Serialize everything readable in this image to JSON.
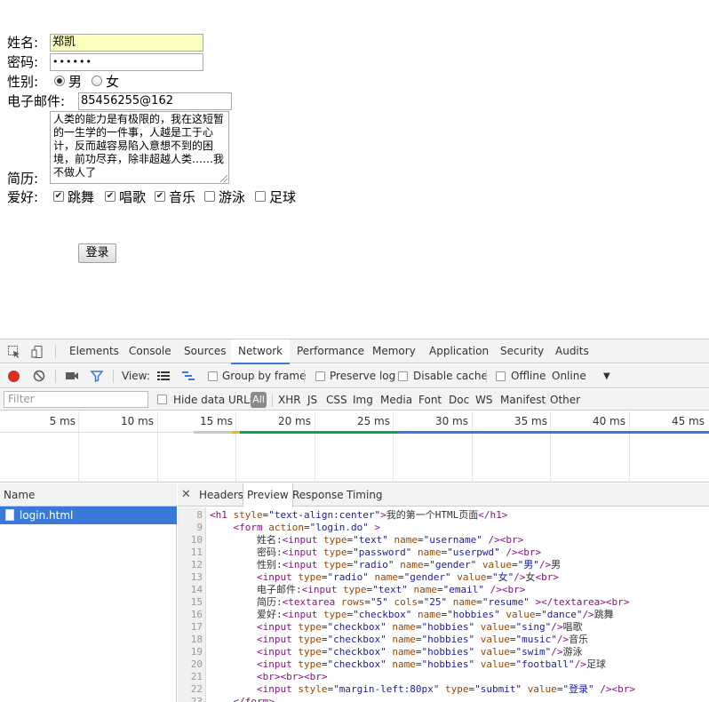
{
  "form": {
    "name_label": "姓名:",
    "name_value": "郑凯",
    "password_label": "密码:",
    "password_value": "••••••",
    "gender_label": "性别:",
    "gender_male": "男",
    "gender_female": "女",
    "email_label": "电子邮件:",
    "email_value": "85456255@162",
    "resume_label": "简历:",
    "resume_value": "人类的能力是有极限的，我在这短暂的一生学的一件事，人越是工于心计，反而越容易陷入意想不到的困境，前功尽弃，除非超越人类……我不做人了",
    "hobby_label": "爱好:",
    "hobbies": [
      {
        "label": "跳舞",
        "checked": true
      },
      {
        "label": "唱歌",
        "checked": true
      },
      {
        "label": "音乐",
        "checked": true
      },
      {
        "label": "游泳",
        "checked": false
      },
      {
        "label": "足球",
        "checked": false
      }
    ],
    "submit_label": "登录"
  },
  "devtools": {
    "tabs": [
      "Elements",
      "Console",
      "Sources",
      "Network",
      "Performance",
      "Memory",
      "Application",
      "Security",
      "Audits"
    ],
    "active_tab": "Network",
    "toolbar": {
      "view_label": "View:",
      "group_by_frame": "Group by frame",
      "preserve_log": "Preserve log",
      "disable_cache": "Disable cache",
      "offline": "Offline",
      "throttle": "Online"
    },
    "filter": {
      "placeholder": "Filter",
      "hide_data_urls": "Hide data URLs",
      "all": "All",
      "types": [
        "XHR",
        "JS",
        "CSS",
        "Img",
        "Media",
        "Font",
        "Doc",
        "WS",
        "Manifest",
        "Other"
      ]
    },
    "timeline_ticks": [
      "5 ms",
      "10 ms",
      "15 ms",
      "20 ms",
      "25 ms",
      "30 ms",
      "35 ms",
      "40 ms",
      "45 ms"
    ],
    "name_header": "Name",
    "requests": [
      "login.html"
    ],
    "detail_tabs": [
      "Headers",
      "Preview",
      "Response",
      "Timing"
    ],
    "active_detail_tab": "Preview",
    "code_lines": [
      {
        "n": "8",
        "html": "<span class='tag'>&lt;h1</span> <span class='attr'>style</span>=<span class='val'>\"text-align:center\"</span><span class='tag'>&gt;</span>我的第一个HTML页面<span class='tag'>&lt;/h1&gt;</span>"
      },
      {
        "n": "9",
        "html": "    <span class='tag'>&lt;form</span> <span class='attr'>action</span>=<span class='val'>\"login.do\"</span> <span class='tag'>&gt;</span>"
      },
      {
        "n": "10",
        "html": "        姓名:<span class='tag'>&lt;input</span> <span class='attr'>type</span>=<span class='val'>\"text\"</span> <span class='attr'>name</span>=<span class='val'>\"username\"</span> <span class='tag'>/&gt;&lt;br&gt;</span>"
      },
      {
        "n": "11",
        "html": "        密码:<span class='tag'>&lt;input</span> <span class='attr'>type</span>=<span class='val'>\"password\"</span> <span class='attr'>name</span>=<span class='val'>\"userpwd\"</span> <span class='tag'>/&gt;&lt;br&gt;</span>"
      },
      {
        "n": "12",
        "html": "        性别:<span class='tag'>&lt;input</span> <span class='attr'>type</span>=<span class='val'>\"radio\"</span> <span class='attr'>name</span>=<span class='val'>\"gender\"</span> <span class='attr'>value</span>=<span class='val'>\"男\"</span><span class='tag'>/&gt;</span>男"
      },
      {
        "n": "13",
        "html": "        <span class='tag'>&lt;input</span> <span class='attr'>type</span>=<span class='val'>\"radio\"</span> <span class='attr'>name</span>=<span class='val'>\"gender\"</span> <span class='attr'>value</span>=<span class='val'>\"女\"</span><span class='tag'>/&gt;</span>女<span class='tag'>&lt;br&gt;</span>"
      },
      {
        "n": "14",
        "html": "        电子邮件:<span class='tag'>&lt;input</span> <span class='attr'>type</span>=<span class='val'>\"text\"</span> <span class='attr'>name</span>=<span class='val'>\"email\"</span> <span class='tag'>/&gt;&lt;br&gt;</span>"
      },
      {
        "n": "15",
        "html": "        简历:<span class='tag'>&lt;textarea</span> <span class='attr'>rows</span>=<span class='val'>\"5\"</span> <span class='attr'>cols</span>=<span class='val'>\"25\"</span> <span class='attr'>name</span>=<span class='val'>\"resume\"</span> <span class='tag'>&gt;&lt;/textarea&gt;&lt;br&gt;</span>"
      },
      {
        "n": "16",
        "html": "        爱好:<span class='tag'>&lt;input</span> <span class='attr'>type</span>=<span class='val'>\"checkbox\"</span> <span class='attr'>name</span>=<span class='val'>\"hobbies\"</span> <span class='attr'>value</span>=<span class='val'>\"dance\"</span><span class='tag'>/&gt;</span>跳舞"
      },
      {
        "n": "17",
        "html": "        <span class='tag'>&lt;input</span> <span class='attr'>type</span>=<span class='val'>\"checkbox\"</span> <span class='attr'>name</span>=<span class='val'>\"hobbies\"</span> <span class='attr'>value</span>=<span class='val'>\"sing\"</span><span class='tag'>/&gt;</span>唱歌"
      },
      {
        "n": "18",
        "html": "        <span class='tag'>&lt;input</span> <span class='attr'>type</span>=<span class='val'>\"checkbox\"</span> <span class='attr'>name</span>=<span class='val'>\"hobbies\"</span> <span class='attr'>value</span>=<span class='val'>\"music\"</span><span class='tag'>/&gt;</span>音乐"
      },
      {
        "n": "19",
        "html": "        <span class='tag'>&lt;input</span> <span class='attr'>type</span>=<span class='val'>\"checkbox\"</span> <span class='attr'>name</span>=<span class='val'>\"hobbies\"</span> <span class='attr'>value</span>=<span class='val'>\"swim\"</span><span class='tag'>/&gt;</span>游泳"
      },
      {
        "n": "20",
        "html": "        <span class='tag'>&lt;input</span> <span class='attr'>type</span>=<span class='val'>\"checkbox\"</span> <span class='attr'>name</span>=<span class='val'>\"hobbies\"</span> <span class='attr'>value</span>=<span class='val'>\"football\"</span><span class='tag'>/&gt;</span>足球"
      },
      {
        "n": "21",
        "html": "        <span class='tag'>&lt;br&gt;&lt;br&gt;&lt;br&gt;</span>"
      },
      {
        "n": "22",
        "html": "        <span class='tag'>&lt;input</span> <span class='attr'>style</span>=<span class='val'>\"margin-left:80px\"</span> <span class='attr'>type</span>=<span class='val'>\"submit\"</span> <span class='attr'>value</span>=<span class='val'>\"登录\"</span> <span class='tag'>/&gt;&lt;br&gt;</span>"
      },
      {
        "n": "23",
        "html": "    <span class='tag'>&lt;/form&gt;</span>"
      }
    ]
  }
}
